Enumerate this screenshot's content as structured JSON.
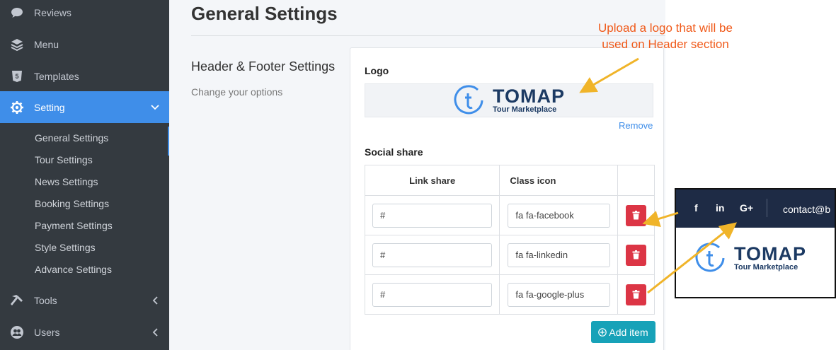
{
  "sidebar": {
    "items": [
      {
        "label": "Reviews",
        "icon": "comment-icon"
      },
      {
        "label": "Menu",
        "icon": "layers-icon"
      },
      {
        "label": "Templates",
        "icon": "html5-icon"
      },
      {
        "label": "Setting",
        "icon": "gear-icon",
        "active": true
      },
      {
        "label": "Tools",
        "icon": "hammer-icon"
      },
      {
        "label": "Users",
        "icon": "users-icon"
      }
    ],
    "sub_items": [
      {
        "label": "General Settings"
      },
      {
        "label": "Tour Settings"
      },
      {
        "label": "News Settings"
      },
      {
        "label": "Booking Settings"
      },
      {
        "label": "Payment Settings"
      },
      {
        "label": "Style Settings"
      },
      {
        "label": "Advance Settings"
      }
    ]
  },
  "page": {
    "title": "General Settings",
    "section_title": "Header & Footer Settings",
    "section_subtitle": "Change your options"
  },
  "logo": {
    "label": "Logo",
    "wordmark": "TOMAP",
    "tagline": "Tour Marketplace",
    "remove_label": "Remove"
  },
  "social": {
    "label": "Social share",
    "columns": [
      "Link share",
      "Class icon"
    ],
    "rows": [
      {
        "link": "#",
        "icon_class": "fa fa-facebook"
      },
      {
        "link": "#",
        "icon_class": "fa fa-linkedin"
      },
      {
        "link": "#",
        "icon_class": "fa fa-google-plus"
      }
    ],
    "add_label": "Add item"
  },
  "annotation": {
    "line1": "Upload a logo that will be",
    "line2": "used on  Header section"
  },
  "preview": {
    "icons": [
      "f",
      "in",
      "G+"
    ],
    "contact": "contact@b",
    "wordmark": "TOMAP",
    "tagline": "Tour Marketplace"
  },
  "colors": {
    "sidebar_bg": "#343a40",
    "active_blue": "#3f8ee9",
    "danger": "#dc3545",
    "info": "#17a2b8",
    "annotation": "#f05a1a",
    "arrow": "#f0b429",
    "brand_navy": "#1c3a63"
  }
}
